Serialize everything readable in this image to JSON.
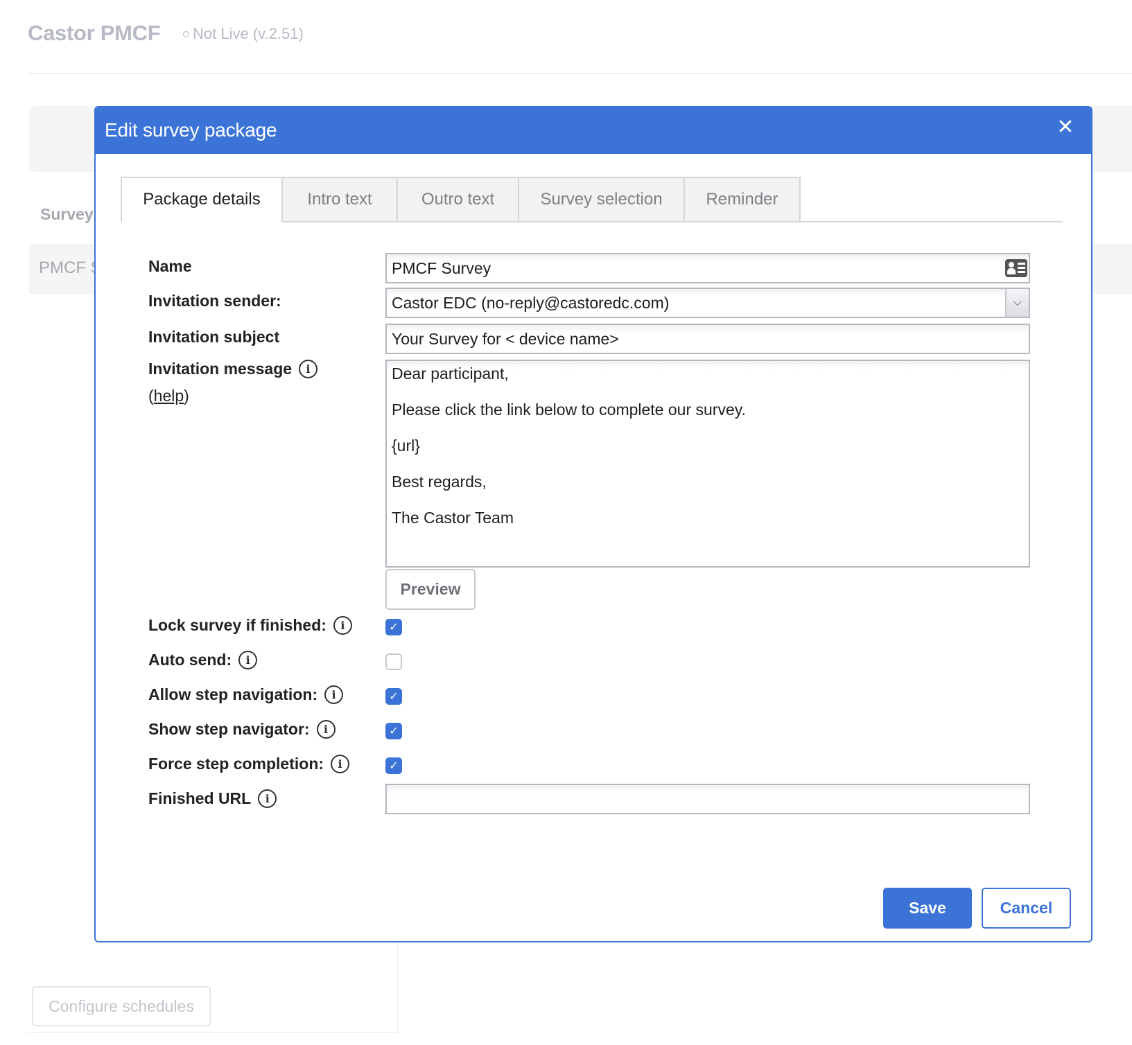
{
  "app": {
    "title": "Castor PMCF",
    "status": "Not Live (v.2.51)"
  },
  "background": {
    "column_header": "Survey",
    "row_text": "PMCF S",
    "configure_label": "Configure schedules"
  },
  "dialog": {
    "title": "Edit survey package",
    "close_icon": "close-icon",
    "tabs": [
      {
        "label": "Package details",
        "active": true
      },
      {
        "label": "Intro text",
        "active": false
      },
      {
        "label": "Outro text",
        "active": false
      },
      {
        "label": "Survey selection",
        "active": false
      },
      {
        "label": "Reminder",
        "active": false
      }
    ],
    "form": {
      "name": {
        "label": "Name",
        "value": "PMCF Survey",
        "icon": "vcard-icon"
      },
      "sender": {
        "label": "Invitation sender:",
        "value": "Castor EDC (no-reply@castoredc.com)"
      },
      "subject": {
        "label": "Invitation subject",
        "value": "Your Survey for < device name>"
      },
      "message": {
        "label": "Invitation message",
        "help_prefix": "(",
        "help_link": "help",
        "help_suffix": ")",
        "lines": [
          "Dear participant,",
          "Please click the link below to complete our survey.",
          "{url}",
          "Best regards,",
          "The Castor Team"
        ],
        "preview_label": "Preview"
      },
      "checkboxes": [
        {
          "label": "Lock survey if finished:",
          "checked": true
        },
        {
          "label": "Auto send:",
          "checked": false
        },
        {
          "label": "Allow step navigation:",
          "checked": true
        },
        {
          "label": "Show step navigator:",
          "checked": true
        },
        {
          "label": "Force step completion:",
          "checked": true
        }
      ],
      "finished_url": {
        "label": "Finished URL",
        "value": ""
      }
    },
    "save_label": "Save",
    "cancel_label": "Cancel"
  },
  "colors": {
    "accent": "#3b74d6",
    "muted_text": "#b7bac4"
  }
}
